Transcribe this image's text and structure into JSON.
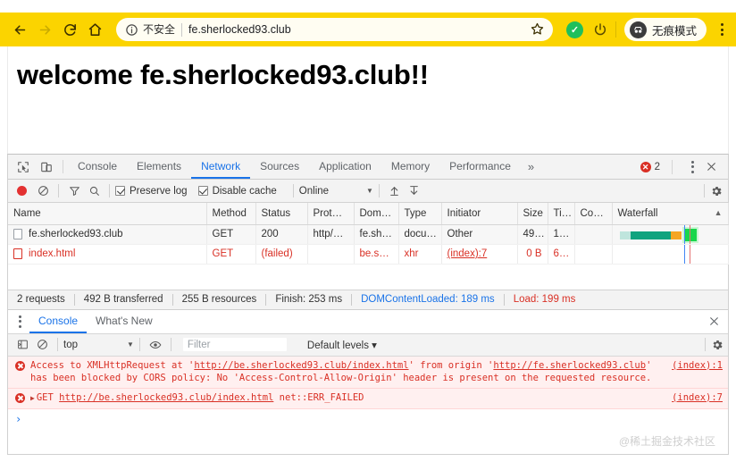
{
  "browser": {
    "back_icon": "arrow-left-icon",
    "forward_icon": "arrow-right-icon",
    "reload_icon": "reload-icon",
    "home_icon": "home-icon",
    "security_label": "不安全",
    "url": "fe.sherlocked93.club",
    "bookmark_icon": "star-icon",
    "extension_badge": "✓",
    "incognito_label": "无痕模式",
    "menu_icon": "kebab-menu-icon"
  },
  "page": {
    "heading": "welcome fe.sherlocked93.club!!"
  },
  "devtools": {
    "tabs": [
      {
        "label": "Console",
        "active": false
      },
      {
        "label": "Elements",
        "active": false
      },
      {
        "label": "Network",
        "active": true
      },
      {
        "label": "Sources",
        "active": false
      },
      {
        "label": "Application",
        "active": false
      },
      {
        "label": "Memory",
        "active": false
      },
      {
        "label": "Performance",
        "active": false
      }
    ],
    "more_tabs": "»",
    "error_count": "2",
    "inspect_icon": "inspect-element-icon",
    "device_toolbar_icon": "device-toggle-icon",
    "settings_icon": "kebab-menu-icon",
    "close_icon": "close-icon"
  },
  "network_toolbar": {
    "record_icon": "record-icon",
    "clear_icon": "clear-icon",
    "filter_icon": "filter-icon",
    "search_icon": "search-icon",
    "preserve_log": "Preserve log",
    "preserve_log_checked": true,
    "disable_cache": "Disable cache",
    "disable_cache_checked": true,
    "throttling": "Online",
    "import_icon": "import-har-icon",
    "export_icon": "export-har-icon",
    "gear_icon": "gear-icon"
  },
  "network_table": {
    "columns": [
      "Name",
      "Method",
      "Status",
      "Prot…",
      "Dom…",
      "Type",
      "Initiator",
      "Size",
      "Ti…",
      "Co…",
      "Waterfall"
    ],
    "sort_indicator": "▲",
    "rows": [
      {
        "name": "fe.sherlocked93.club",
        "method": "GET",
        "status": "200",
        "protocol": "http/…",
        "domain": "fe.sh…",
        "type": "docu…",
        "initiator": "Other",
        "size": "49…",
        "time": "1…",
        "connection": "",
        "failed": false
      },
      {
        "name": "index.html",
        "method": "GET",
        "status": "(failed)",
        "protocol": "",
        "domain": "be.s…",
        "type": "xhr",
        "initiator": "(index):7",
        "size": "0 B",
        "time": "6…",
        "connection": "",
        "failed": true
      }
    ]
  },
  "network_summary": {
    "requests": "2 requests",
    "transferred": "492 B transferred",
    "resources": "255 B resources",
    "finish": "Finish: 253 ms",
    "dom_content_loaded": "DOMContentLoaded: 189 ms",
    "load": "Load: 199 ms"
  },
  "drawer": {
    "tabs": [
      {
        "label": "Console",
        "active": true
      },
      {
        "label": "What's New",
        "active": false
      }
    ],
    "close_icon": "close-icon"
  },
  "console_toolbar": {
    "sidebar_icon": "console-sidebar-icon",
    "clear_icon": "clear-console-icon",
    "context": "top",
    "eye_icon": "live-expression-icon",
    "filter_placeholder": "Filter",
    "levels": "Default levels ▾",
    "gear_icon": "gear-icon"
  },
  "console_messages": [
    {
      "icon": "error-icon",
      "prefix": "Access to XMLHttpRequest at '",
      "link1": "http://be.sherlocked93.club/index.html",
      "mid": "' from origin '",
      "link2": "http://fe.sherlocked93.club",
      "suffix": "' has been blocked by CORS policy: No 'Access-Control-Allow-Origin' header is present on the requested resource.",
      "source": "(index):1"
    },
    {
      "icon": "error-icon",
      "expander": "▶",
      "method": "GET",
      "url": "http://be.sherlocked93.club/index.html",
      "error": "net::ERR_FAILED",
      "source": "(index):7"
    }
  ],
  "prompt": {
    "caret": "›"
  },
  "watermark": "@稀土掘金技术社区",
  "colors": {
    "incognito_yellow": "#fbd400",
    "error_red": "#d93025",
    "link_blue": "#1a73e8",
    "waterfall_teal": "#10a37f",
    "waterfall_orange": "#f5a623",
    "waterfall_green": "#19d64b"
  }
}
